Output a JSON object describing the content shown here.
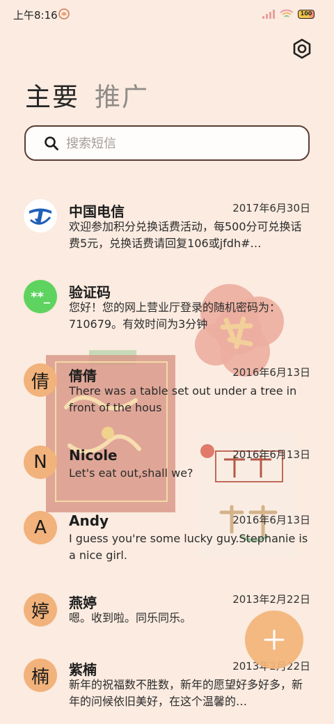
{
  "status_bar": {
    "time": "上午8:16",
    "battery_label": "100",
    "icons": [
      "candy-icon",
      "signal-icon",
      "wifi-icon",
      "battery-icon"
    ]
  },
  "settings": {
    "icon": "gear-icon"
  },
  "tabs": [
    {
      "label": "主要",
      "active": true
    },
    {
      "label": "推广",
      "active": false
    }
  ],
  "search": {
    "placeholder": "搜索短信",
    "value": ""
  },
  "wallpaper_text": [
    "发",
    "未来",
    "可期"
  ],
  "messages": [
    {
      "sender": "中国电信",
      "date": "2017年6月30日",
      "preview": "欢迎参加积分兑换话费活动，每500分可兑换话费5元，兑换话费请回复106或jfdh#…",
      "avatar": "telecom-logo"
    },
    {
      "sender": "验证码",
      "date": "",
      "preview": "您好！您的网上营业厅登录的随机密码为：710679。有效时间为3分钟",
      "avatar": "**_"
    },
    {
      "sender": "倩倩",
      "date": "2016年6月13日",
      "preview": "There was a table set out under a tree in front of the hous",
      "avatar": "倩"
    },
    {
      "sender": "Nicole",
      "date": "2016年6月13日",
      "preview": "Let's eat out,shall we?",
      "avatar": "N"
    },
    {
      "sender": "Andy",
      "date": "2016年6月13日",
      "preview": "I guess you're some lucky guy.Stephanie is a nice girl.",
      "avatar": "A"
    },
    {
      "sender": "燕婷",
      "date": "2013年2月22日",
      "preview": "嗯。收到啦。同乐同乐。",
      "avatar": "婷"
    },
    {
      "sender": "紫楠",
      "date": "2013年2月22日",
      "preview": "新年的祝福数不胜数，新年的愿望好多好多，新年的问候依旧美好，在这个温馨的…",
      "avatar": "楠"
    }
  ],
  "fab": {
    "icon": "plus-icon"
  },
  "colors": {
    "background": "#fbebe0",
    "avatar_orange": "#f2b27b",
    "code_avatar_green": "#5fd35f",
    "telecom_blue": "#1f5fb8",
    "fab": "#f2b478"
  }
}
